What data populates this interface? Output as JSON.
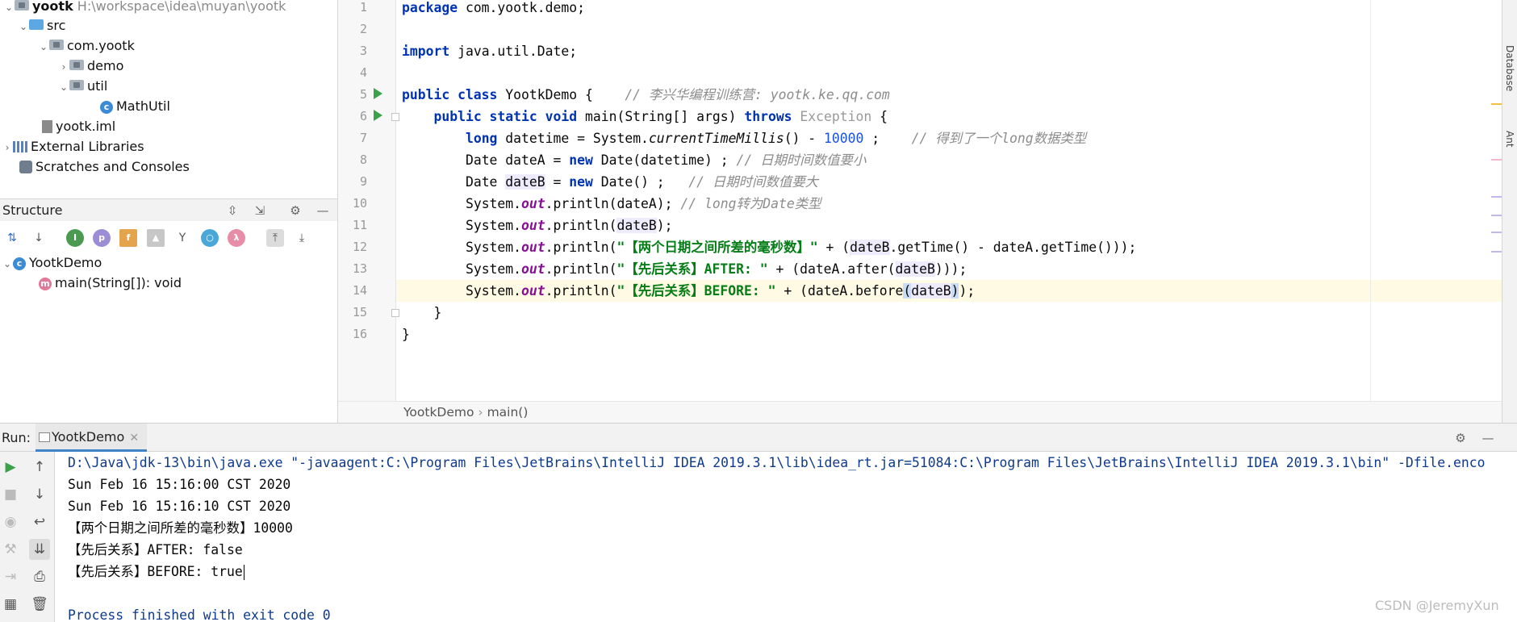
{
  "project_tree": {
    "root_name": "yootk",
    "root_path": "H:\\workspace\\idea\\muyan\\yootk",
    "items": [
      {
        "label": "src"
      },
      {
        "label": "com.yootk"
      },
      {
        "label": "demo"
      },
      {
        "label": "util"
      },
      {
        "label": "MathUtil"
      },
      {
        "label": "yootk.iml"
      },
      {
        "label": "External Libraries"
      },
      {
        "label": "Scratches and Consoles"
      }
    ]
  },
  "structure": {
    "title": "Structure",
    "tree": [
      "YootkDemo",
      "main(String[]): void"
    ]
  },
  "editor": {
    "line_numbers": [
      "1",
      "2",
      "3",
      "4",
      "5",
      "6",
      "7",
      "8",
      "9",
      "10",
      "11",
      "12",
      "13",
      "14",
      "15",
      "16"
    ],
    "code": {
      "l1_kw": "package",
      "l1_rest": " com.yootk.demo;",
      "l3_kw": "import",
      "l3_rest": " java.util.Date;",
      "l5_kw": "public class",
      "l5_name": " YootkDemo {    ",
      "l5_comment": "// 李兴华编程训练营: yootk.ke.qq.com",
      "l6_kw1": "public static void",
      "l6_mid": " main(String[] args) ",
      "l6_kw2": "throws",
      "l6_ex": " Exception",
      "l6_end": " {",
      "l7_kw": "long",
      "l7_a": " datetime = System.",
      "l7_m": "currentTimeMillis",
      "l7_b": "() - ",
      "l7_num": "10000",
      "l7_c": " ;    ",
      "l7_comment": "// 得到了一个long数据类型",
      "l8_a": "Date dateA = ",
      "l8_kw": "new",
      "l8_b": " Date(datetime) ; ",
      "l8_comment": "// 日期时间数值要小",
      "l9_a": "Date ",
      "l9_var": "dateB",
      "l9_b": " = ",
      "l9_kw": "new",
      "l9_c": " Date() ;   ",
      "l9_comment": "// 日期时间数值要大",
      "sys": "System.",
      "out": "out",
      "l10_rest": ".println(dateA); ",
      "l10_comment": "// long转为Date类型",
      "l11_a": ".println(",
      "l11_var": "dateB",
      "l11_b": ");",
      "l12_a": ".println(",
      "l12_str": "\"【两个日期之间所差的毫秒数】\"",
      "l12_b": " + (",
      "l12_var": "dateB",
      "l12_c": ".getTime() - dateA.getTime()));",
      "l13_a": ".println(",
      "l13_str": "\"【先后关系】AFTER: \"",
      "l13_b": " + (dateA.after(",
      "l13_var": "dateB",
      "l13_c": ")));",
      "l14_a": ".println(",
      "l14_str": "\"【先后关系】BEFORE: \"",
      "l14_b": " + (dateA.before",
      "l14_p1": "(",
      "l14_var": "dateB",
      "l14_p2": ")",
      "l14_c": ");",
      "l15": "}",
      "l16": "}"
    },
    "breadcrumb": [
      "YootkDemo",
      "main()"
    ]
  },
  "right_strip": [
    "Database",
    "Ant"
  ],
  "run_panel": {
    "label": "Run:",
    "tab": "YootkDemo",
    "console_lines": [
      "D:\\Java\\jdk-13\\bin\\java.exe \"-javaagent:C:\\Program Files\\JetBrains\\IntelliJ IDEA 2019.3.1\\lib\\idea_rt.jar=51084:C:\\Program Files\\JetBrains\\IntelliJ IDEA 2019.3.1\\bin\" -Dfile.enco",
      "Sun Feb 16 15:16:00 CST 2020",
      "Sun Feb 16 15:16:10 CST 2020",
      "【两个日期之间所差的毫秒数】10000",
      "【先后关系】AFTER: false",
      "【先后关系】BEFORE: true",
      "Process finished with exit code 0"
    ]
  },
  "watermark": "CSDN @JeremyXun",
  "colors": {
    "keyword": "#0033b3",
    "string": "#067d17",
    "comment": "#8c8c8c",
    "number": "#1750eb",
    "field": "#871094",
    "current_line": "#fffae3",
    "run_arrow": "#3aa34a"
  }
}
